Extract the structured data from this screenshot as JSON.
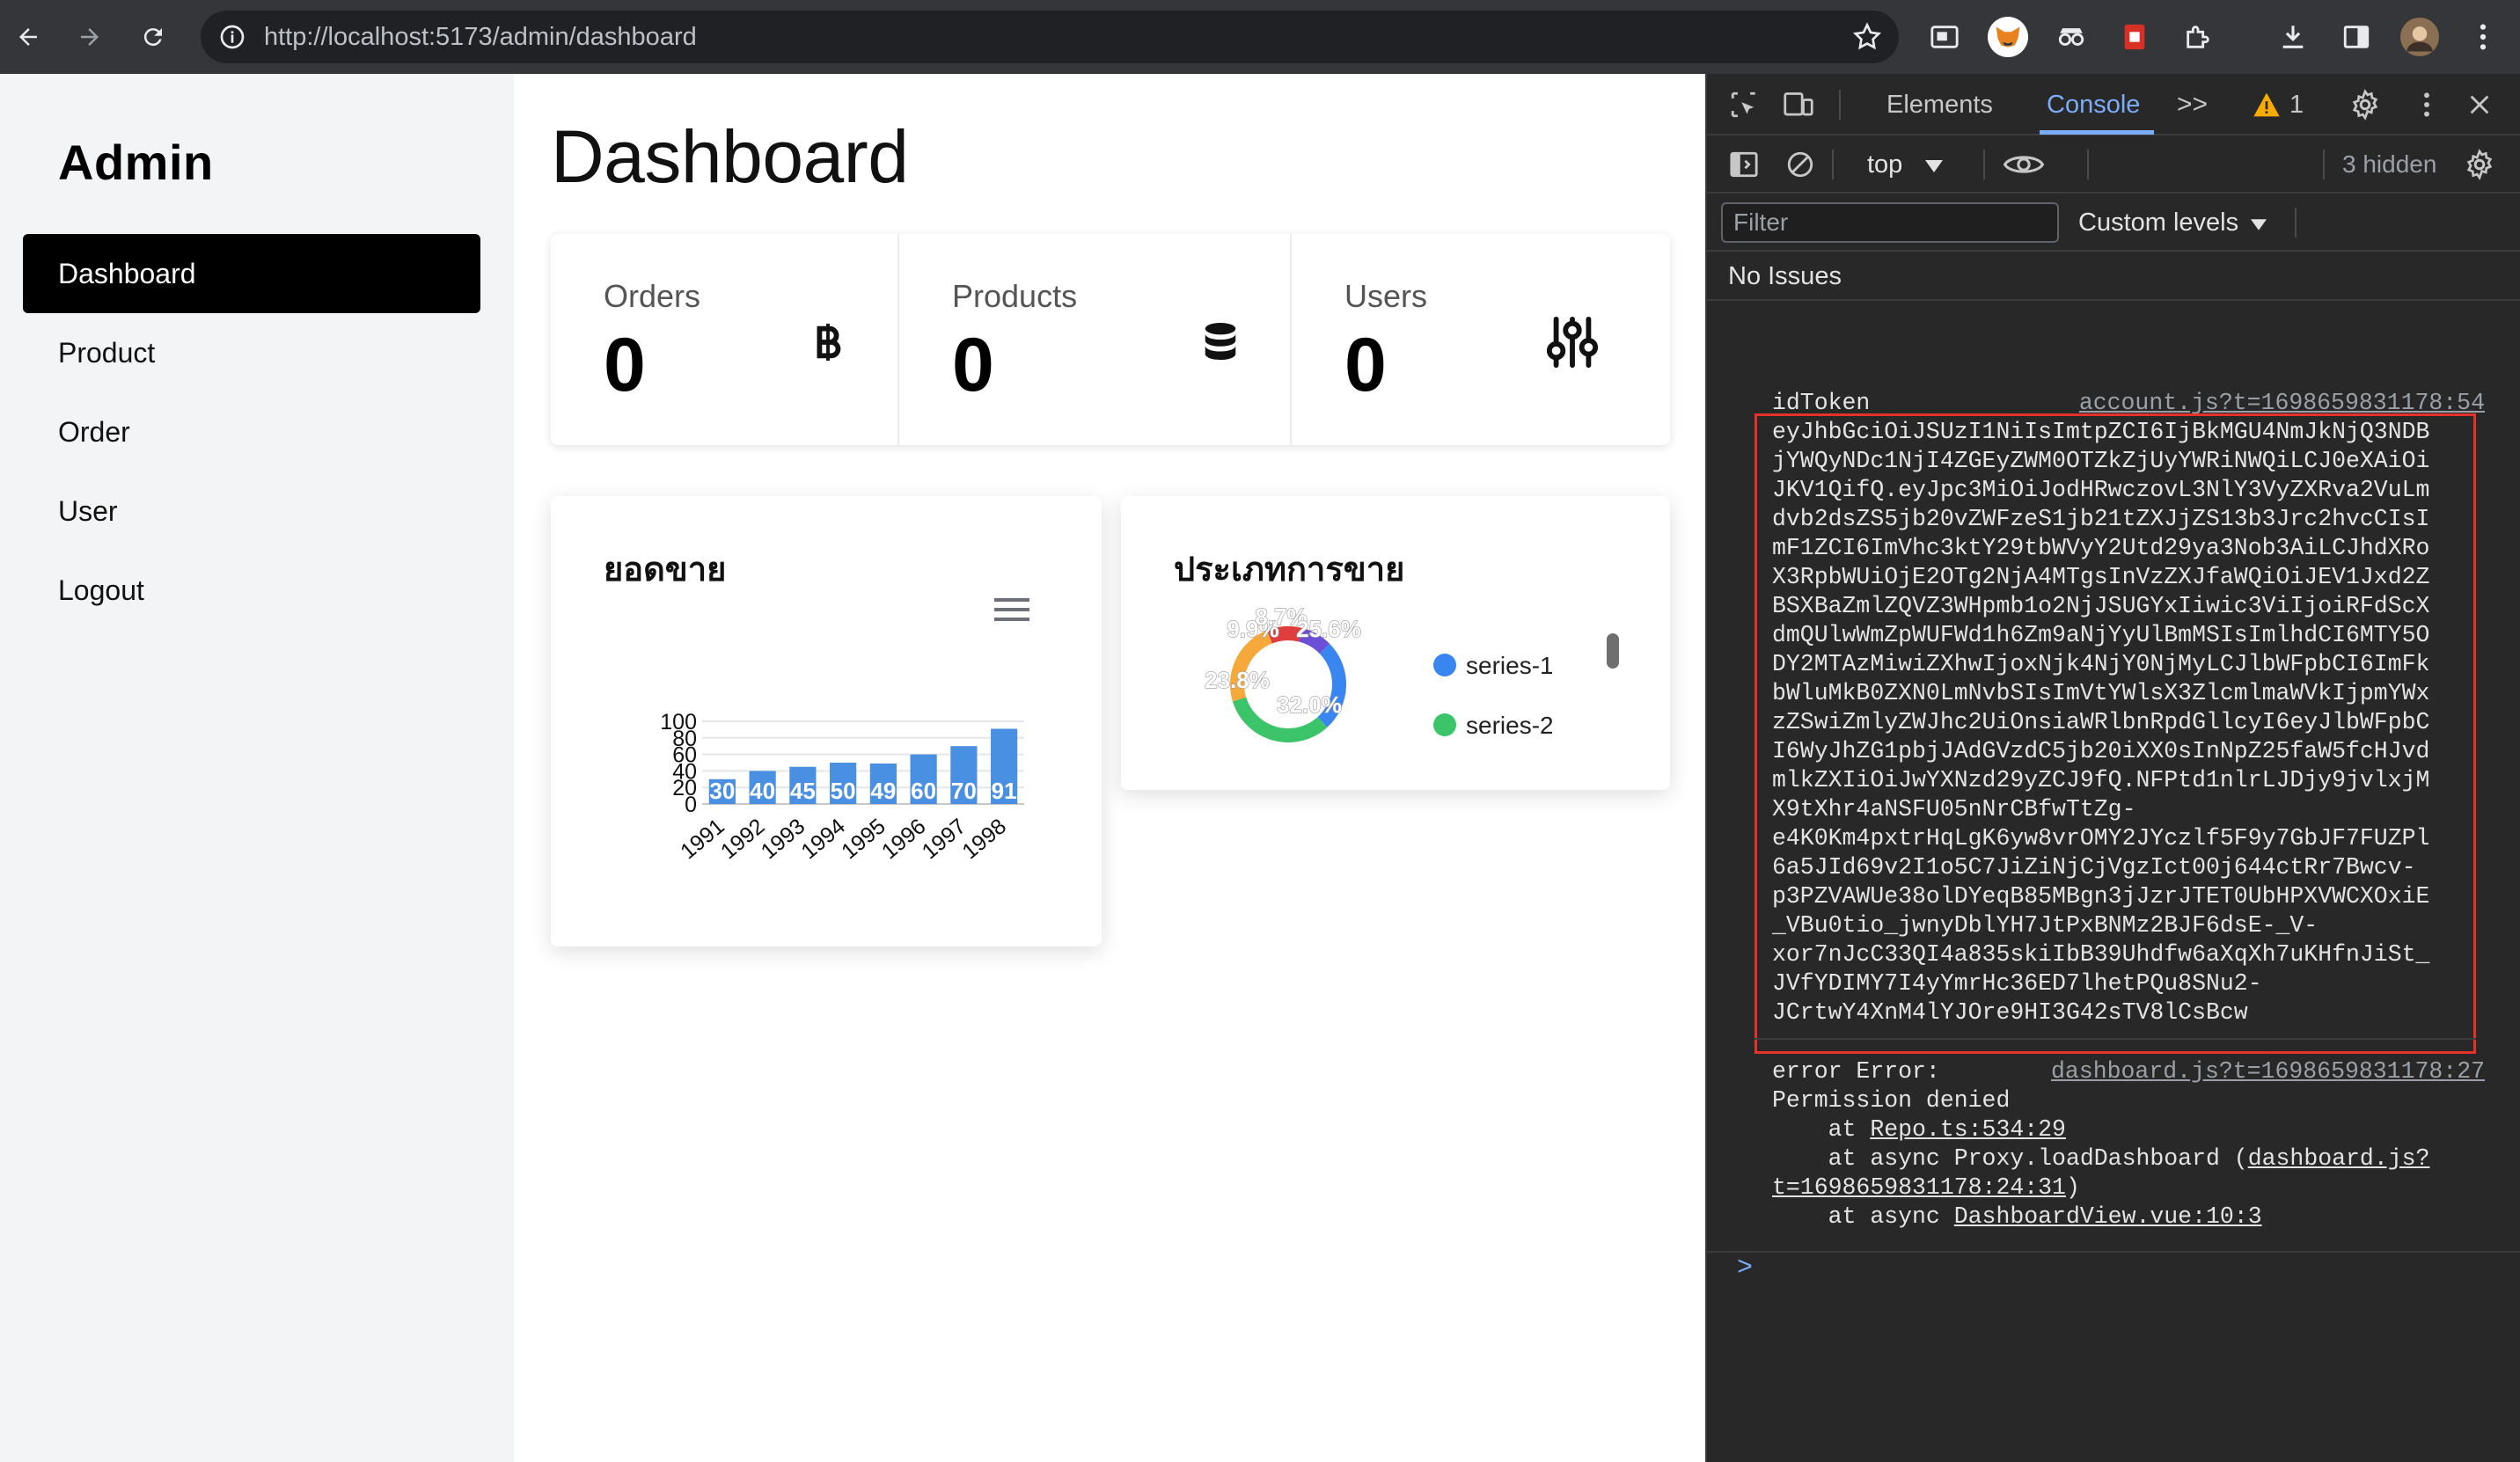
{
  "browser": {
    "url_host": "http://localhost",
    "url_path": ":5173/admin/dashboard"
  },
  "sidebar": {
    "brand": "Admin",
    "items": [
      {
        "label": "Dashboard",
        "active": true
      },
      {
        "label": "Product",
        "active": false
      },
      {
        "label": "Order",
        "active": false
      },
      {
        "label": "User",
        "active": false
      },
      {
        "label": "Logout",
        "active": false
      }
    ]
  },
  "main": {
    "title": "Dashboard",
    "stats": [
      {
        "label": "Orders",
        "value": "0",
        "icon": "baht-icon"
      },
      {
        "label": "Products",
        "value": "0",
        "icon": "database-icon"
      },
      {
        "label": "Users",
        "value": "0",
        "icon": "sliders-icon"
      }
    ]
  },
  "sales_card": {
    "title": "ยอดขาย"
  },
  "type_card": {
    "title": "ประเภทการขาย"
  },
  "chart_data": [
    {
      "type": "bar",
      "title": "ยอดขาย",
      "categories": [
        "1991",
        "1992",
        "1993",
        "1994",
        "1995",
        "1996",
        "1997",
        "1998"
      ],
      "values": [
        30,
        40,
        45,
        50,
        49,
        60,
        70,
        91
      ],
      "ylim": [
        0,
        100
      ],
      "yticks": [
        "0",
        "20",
        "40",
        "60",
        "80",
        "100"
      ],
      "grid": true,
      "color": "#4a90e2"
    },
    {
      "type": "pie",
      "title": "ประเภทการขาย",
      "donut": true,
      "labels": [
        "9.9%",
        "8.7%",
        "25.6%",
        "32.0%",
        "23.8%"
      ],
      "values": [
        9.9,
        8.7,
        25.6,
        32.0,
        23.8
      ],
      "colors": [
        "#e03e3e",
        "#6b4fd6",
        "#3a86f0",
        "#3cc46a",
        "#f4a93a"
      ],
      "legend": [
        "series-1",
        "series-2"
      ],
      "legend_colors": [
        "#3a86f0",
        "#3cc46a"
      ],
      "legend_position": "right"
    }
  ],
  "devtools": {
    "tabs": [
      "Elements",
      "Console"
    ],
    "active_tab": "Console",
    "more": ">>",
    "warning_count": "1",
    "context": "top",
    "hidden_count": "3 hidden",
    "filter_placeholder": "Filter",
    "levels": "Custom levels",
    "issues": "No Issues",
    "token_label": "idToken",
    "token_source": "account.js?t=1698659831178:54",
    "token_lines": [
      "eyJhbGciOiJSUzI1NiIsImtpZCI6IjBkMGU4NmJkNjQ3NDB",
      "jYWQyNDc1NjI4ZGEyZWM0OTZkZjUyYWRiNWQiLCJ0eXAiOi",
      "JKV1QifQ.eyJpc3MiOiJodHRwczovL3NlY3VyZXRva2VuLm",
      "dvb2dsZS5jb20vZWFzeS1jb21tZXJjZS13b3Jrc2hvcCIsI",
      "mF1ZCI6ImVhc3ktY29tbWVyY2Utd29ya3Nob3AiLCJhdXRo",
      "X3RpbWUiOjE2OTg2NjA4MTgsInVzZXJfaWQiOiJEV1Jxd2Z",
      "BSXBaZmlZQVZ3WHpmb1o2NjJSUGYxIiwic3ViIjoiRFdScX",
      "dmQUlwWmZpWUFWd1h6Zm9aNjYyUlBmMSIsImlhdCI6MTY5O",
      "DY2MTAzMiwiZXhwIjoxNjk4NjY0NjMyLCJlbWFpbCI6ImFk",
      "bWluMkB0ZXN0LmNvbSIsImVtYWlsX3ZlcmlmaWVkIjpmYWx",
      "zZSwiZmlyZWJhc2UiOnsiaWRlbnRpdGllcyI6eyJlbWFpbC",
      "I6WyJhZG1pbjJAdGVzdC5jb20iXX0sInNpZ25faW5fcHJvd",
      "mlkZXIiOiJwYXNzd29yZCJ9fQ.NFPtd1nlrLJDjy9jvlxjM",
      "X9tXhr4aNSFU05nNrCBfwTtZg-",
      "e4K0Km4pxtrHqLgK6yw8vrOMY2JYczlf5F9y7GbJF7FUZPl",
      "6a5JId69v2I1o5C7JiZiNjCjVgzIct00j644ctRr7Bwcv-",
      "p3PZVAWUe38olDYeqB85MBgn3jJzrJTET0UbHPXVWCXOxiE",
      "_VBu0tio_jwnyDblYH7JtPxBNMz2BJF6dsE-_V-",
      "xor7nJcC33QI4a835skiIbB39Uhdfw6aXqXh7uKHfnJiSt_",
      "JVfYDIMY7I4yYmrHc36ED7lhetPQu8SNu2-",
      "JCrtwY4XnM4lYJOre9HI3G42sTV8lCsBcw"
    ],
    "error_label": "error Error:",
    "error_source": "dashboard.js?t=1698659831178:27",
    "error_message": "Permission denied",
    "trace": {
      "line1_prefix": "    at ",
      "line1_link": "Repo.ts:534:29",
      "line2_prefix": "    at async Proxy.loadDashboard (",
      "line2_link": "dashboard.js?",
      "line3_link": "t=1698659831178:24:31",
      "line3_suffix": ")",
      "line4_prefix": "    at async ",
      "line4_link": "DashboardView.vue:10:3"
    },
    "prompt": ">"
  }
}
